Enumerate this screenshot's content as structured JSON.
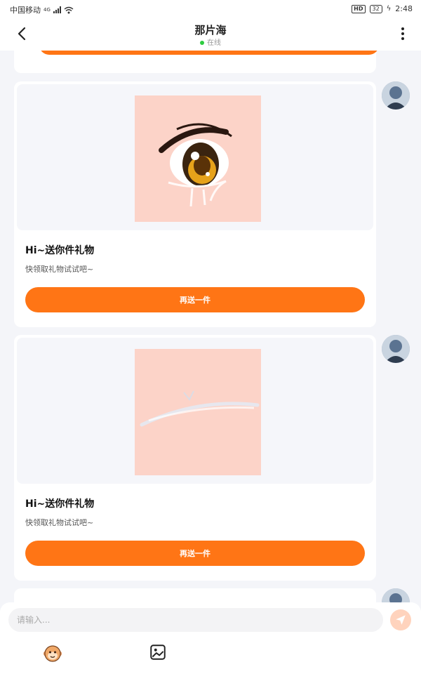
{
  "status_bar": {
    "carrier": "中国移动",
    "network": "4G",
    "hd_badge": "HD",
    "battery": "32",
    "time": "2:48"
  },
  "header": {
    "title": "那片海",
    "status": "在线",
    "back_icon": "chevron-left-icon",
    "more_icon": "more-vertical-icon"
  },
  "messages": [
    {
      "title": "Hi~送你件礼物",
      "subtitle": "快领取礼物试试吧~",
      "button": "再送一件",
      "image": "anime-eye-sticker"
    },
    {
      "title": "Hi~送你件礼物",
      "subtitle": "快领取礼物试试吧~",
      "button": "再送一件",
      "image": "closed-eye-sticker"
    }
  ],
  "input": {
    "placeholder": "请输入...",
    "value": ""
  },
  "toolbar": {
    "emoji_icon": "monkey-emoji-icon",
    "image_icon": "image-icon",
    "send_icon": "send-icon"
  },
  "colors": {
    "accent": "#ff7515",
    "online": "#2ecc40",
    "send_button": "#ffd3bd",
    "gift_bg": "#fcd3c8"
  }
}
